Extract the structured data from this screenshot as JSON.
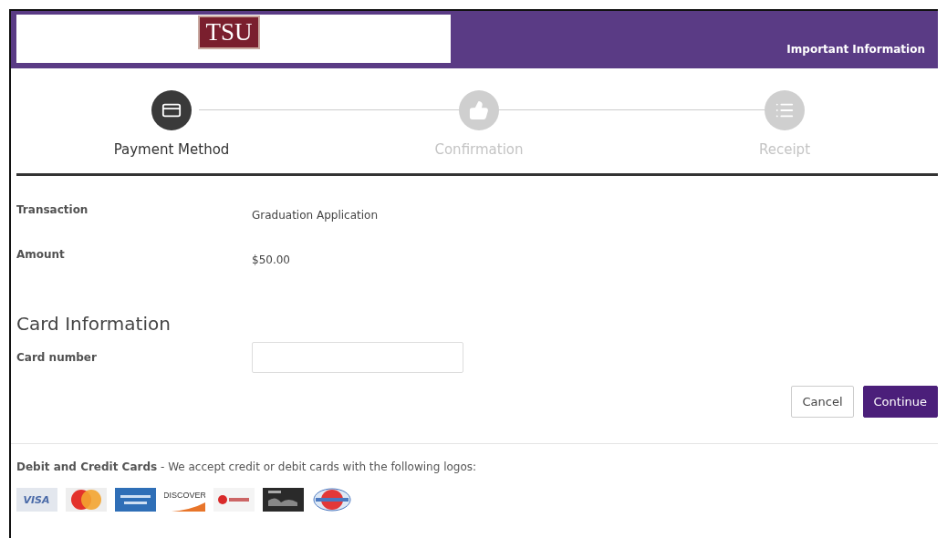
{
  "header": {
    "logo_text": "TSU",
    "link": "Important Information"
  },
  "steps": [
    {
      "label": "Payment Method",
      "selected": true
    },
    {
      "label": "Confirmation",
      "selected": false
    },
    {
      "label": "Receipt",
      "selected": false
    }
  ],
  "details": [
    {
      "label": "Transaction",
      "value": "Graduation Application"
    },
    {
      "label": "Amount",
      "value": "$50.00"
    }
  ],
  "card_section": {
    "title": "Card Information",
    "field_label": "Card number"
  },
  "buttons": [
    {
      "label": "Cancel",
      "kind": "secondary"
    },
    {
      "label": "Continue",
      "kind": "primary"
    }
  ],
  "accepted": {
    "title": "Debit and Credit Cards",
    "text": " - We accept credit or debit cards with the following logos:"
  },
  "card_logos": [
    {
      "kind": "visa",
      "label": "VISA"
    },
    {
      "kind": "mastercard"
    },
    {
      "kind": "amex"
    },
    {
      "kind": "discover",
      "label": "DISCOVER"
    },
    {
      "kind": "bccard"
    },
    {
      "kind": "dark"
    },
    {
      "kind": "diners"
    }
  ]
}
